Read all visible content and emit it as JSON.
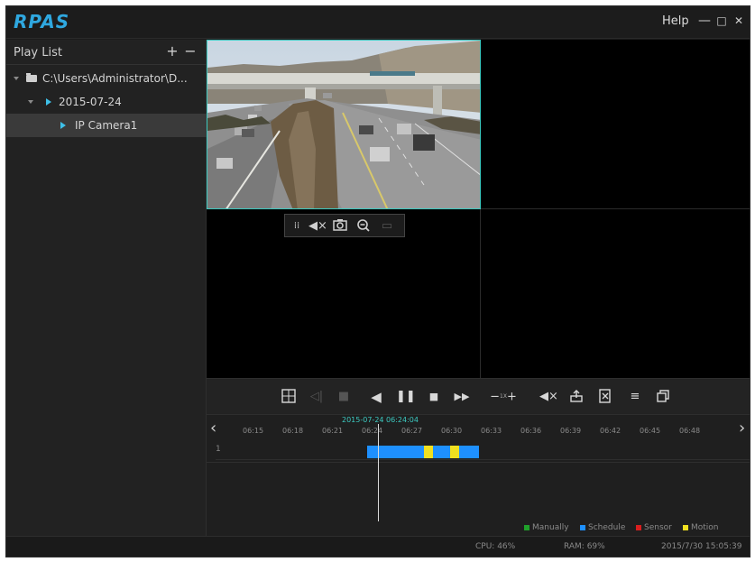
{
  "app": {
    "logo": "RPAS",
    "help": "Help",
    "minimize": "—",
    "maximize": "□",
    "close": "✕"
  },
  "sidebar": {
    "title": "Play List",
    "add": "+",
    "remove": "−",
    "tree": [
      {
        "label": "C:\\Users\\Administrator\\D...",
        "level": 0,
        "type": "folder"
      },
      {
        "label": "2015-07-24",
        "level": 1,
        "type": "date"
      },
      {
        "label": "IP Camera1",
        "level": 2,
        "type": "camera",
        "selected": true
      }
    ]
  },
  "camera_toolbar": {
    "icons": [
      "drag-handle-icon",
      "mute-icon",
      "snapshot-icon",
      "zoom-icon",
      "fullscreen-icon"
    ]
  },
  "controls": {
    "speed": "1X",
    "icons": [
      "layout-icon",
      "prev-frame-icon",
      "stop-dim-icon",
      "rewind-icon",
      "pause-icon",
      "stop-icon",
      "fast-forward-icon",
      "speed-control",
      "mute-icon",
      "export-icon",
      "clip-icon",
      "list-icon",
      "window-icon"
    ]
  },
  "timeline": {
    "current_time": "2015-07-24 06:24:04",
    "ticks": [
      "06:15",
      "06:18",
      "06:21",
      "06:24",
      "06:27",
      "06:30",
      "06:33",
      "06:36",
      "06:39",
      "06:42",
      "06:45",
      "06:48"
    ],
    "track_number": "1",
    "legend": [
      {
        "label": "Manually",
        "color": "#1fa02a"
      },
      {
        "label": "Schedule",
        "color": "#1e90ff"
      },
      {
        "label": "Sensor",
        "color": "#d81e1e"
      },
      {
        "label": "Motion",
        "color": "#f0e020"
      }
    ]
  },
  "status": {
    "cpu": "CPU: 46%",
    "ram": "RAM: 69%",
    "datetime": "2015/7/30 15:05:39"
  }
}
